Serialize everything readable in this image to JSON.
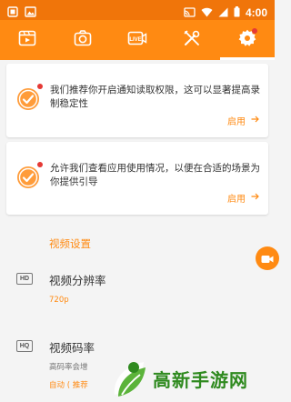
{
  "status_bar": {
    "time": "4:00",
    "left_icons": [
      "app-icon",
      "image-icon"
    ],
    "right_icons": [
      "cast-icon",
      "wifi-icon",
      "signal-icon",
      "battery-icon"
    ]
  },
  "toolbar": {
    "tabs": [
      {
        "icon": "video-list-icon",
        "active": false
      },
      {
        "icon": "camera-icon",
        "active": false
      },
      {
        "icon": "live-icon",
        "active": false
      },
      {
        "icon": "tools-icon",
        "active": false
      },
      {
        "icon": "gear-icon",
        "active": true,
        "badge": true
      }
    ]
  },
  "cards": [
    {
      "message": "我们推荐你开启通知读取权限，这可以显著提高录制稳定性",
      "action": "启用"
    },
    {
      "message": "允许我们查看应用使用情况，以便在合适的场景为你提供引导",
      "action": "启用"
    }
  ],
  "settings": {
    "section_title": "视频设置",
    "rows": [
      {
        "icon_text": "HD",
        "title": "视频分辨率",
        "value": "720p"
      },
      {
        "icon_text": "HQ",
        "title": "视频码率",
        "description": "高码率会增",
        "value": "自动 ( 推荐"
      }
    ]
  },
  "watermark": {
    "text": "高新手游网"
  },
  "colors": {
    "accent": "#ff8a12",
    "status_bar": "#f0750a",
    "badge": "#e53935",
    "watermark": "#2f8a1f"
  }
}
